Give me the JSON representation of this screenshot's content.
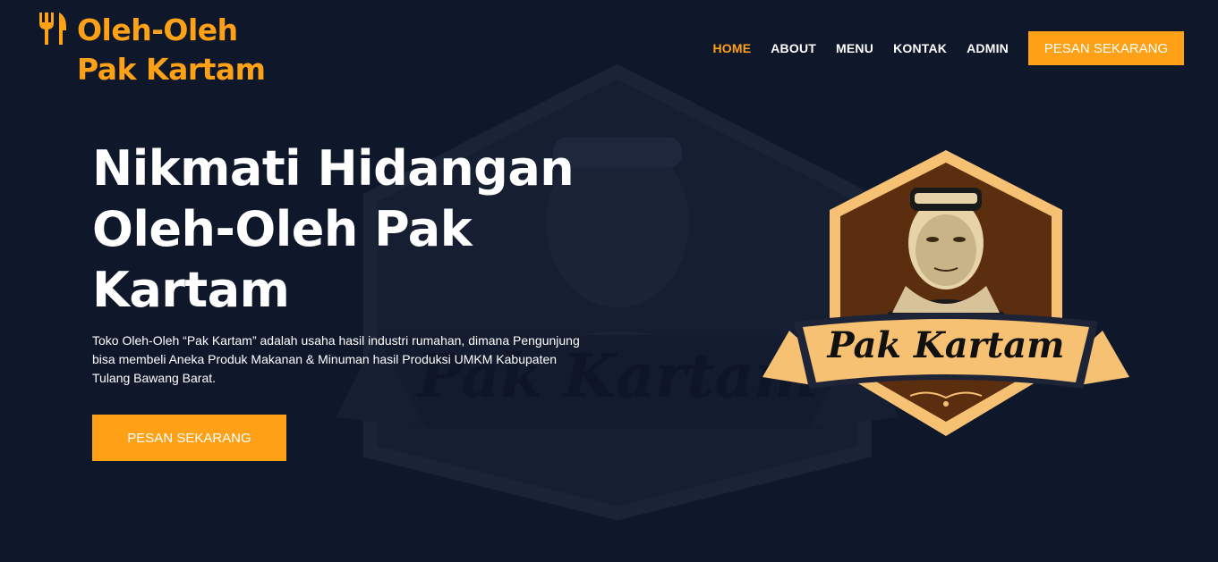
{
  "brand": {
    "line1": "Oleh-Oleh",
    "line2": "Pak Kartam",
    "icon": "utensils-icon",
    "color": "#fea116"
  },
  "nav": {
    "items": [
      {
        "label": "HOME",
        "active": true
      },
      {
        "label": "ABOUT",
        "active": false
      },
      {
        "label": "MENU",
        "active": false
      },
      {
        "label": "KONTAK",
        "active": false
      },
      {
        "label": "ADMIN",
        "active": false
      }
    ],
    "cta_label": "PESAN SEKARANG"
  },
  "hero": {
    "title": "Nikmati Hidangan Oleh-Oleh Pak Kartam",
    "description": "Toko Oleh-Oleh “Pak Kartam” adalah usaha hasil industri rumahan, dimana Pengunjung bisa membeli Aneka Produk Makanan & Minuman hasil Produksi UMKM Kabupaten Tulang Bawang Barat.",
    "cta_label": "PESAN SEKARANG"
  },
  "logo": {
    "banner_text": "Pak Kartam"
  },
  "colors": {
    "background": "#0f172b",
    "accent": "#fea116",
    "text": "#ffffff"
  }
}
